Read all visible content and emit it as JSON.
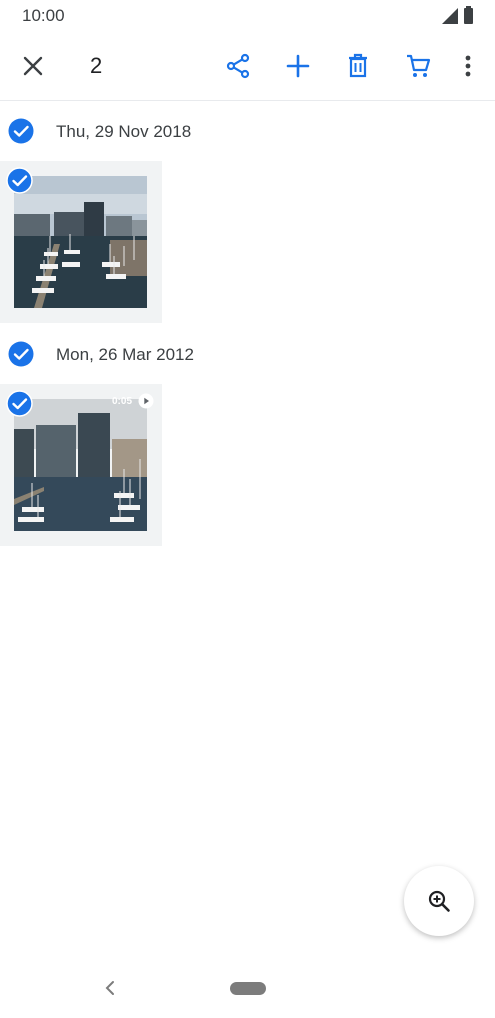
{
  "status": {
    "time": "10:00"
  },
  "toolbar": {
    "selected_count": "2",
    "icons": [
      "close-icon",
      "share-icon",
      "add-icon",
      "delete-icon",
      "cart-icon",
      "more-vert-icon"
    ]
  },
  "groups": [
    {
      "date": "Thu, 29 Nov 2018",
      "items": [
        {
          "type": "photo",
          "selected": true
        }
      ]
    },
    {
      "date": "Mon, 26 Mar 2012",
      "items": [
        {
          "type": "video",
          "duration": "0:05",
          "selected": true
        }
      ]
    }
  ],
  "colors": {
    "accent": "#1a73e8",
    "thumb_bg": "#f1f3f4"
  }
}
